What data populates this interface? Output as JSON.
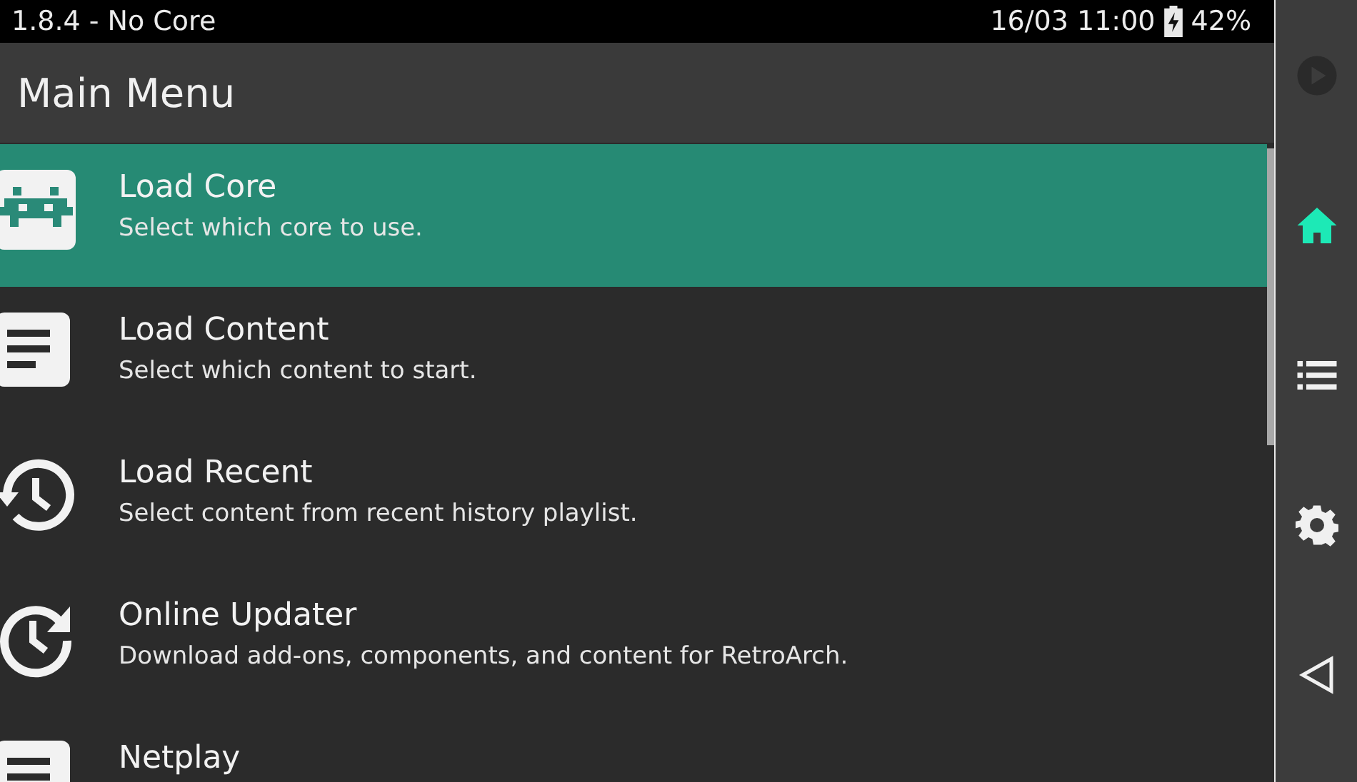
{
  "status_bar": {
    "version": "1.8.4 - No Core",
    "datetime": "16/03 11:00",
    "battery": "42%"
  },
  "header": {
    "title": "Main Menu"
  },
  "menu_items": [
    {
      "kind": "invader",
      "title": "Load Core",
      "subtitle": "Select which core to use.",
      "selected": true
    },
    {
      "kind": "file",
      "title": "Load Content",
      "subtitle": "Select which content to start.",
      "selected": false
    },
    {
      "kind": "history",
      "title": "Load Recent",
      "subtitle": "Select content from recent history playlist.",
      "selected": false
    },
    {
      "kind": "update",
      "title": "Online Updater",
      "subtitle": "Download add-ons, components, and content for RetroArch.",
      "selected": false
    },
    {
      "kind": "file",
      "title": "Netplay",
      "selected": false
    }
  ],
  "sidebar": [
    {
      "kind": "play",
      "selected": false,
      "disabled": true
    },
    {
      "kind": "home",
      "selected": true,
      "disabled": false
    },
    {
      "kind": "list",
      "selected": false,
      "disabled": false
    },
    {
      "kind": "gear",
      "selected": false,
      "disabled": false
    },
    {
      "kind": "back",
      "selected": false,
      "disabled": false
    }
  ]
}
